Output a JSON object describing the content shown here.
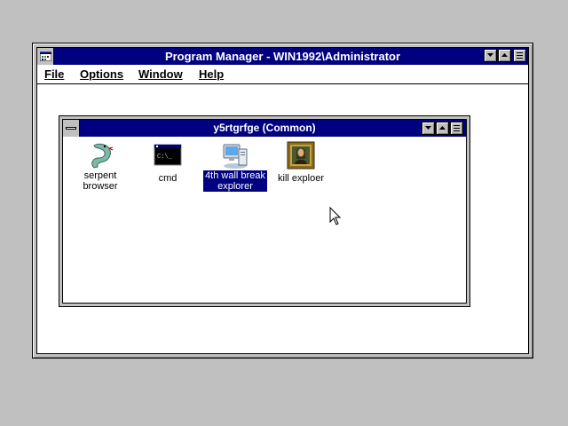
{
  "program_manager": {
    "title": "Program Manager - WIN1992\\Administrator",
    "menu": [
      "File",
      "Options",
      "Window",
      "Help"
    ]
  },
  "group": {
    "title": "y5rtgrfge (Common)",
    "icons": [
      {
        "label": "serpent\nbrowser",
        "icon": "serpent-icon",
        "selected": false
      },
      {
        "label": "cmd",
        "icon": "command-prompt-icon",
        "selected": false
      },
      {
        "label": "4th wall break\nexplorer",
        "icon": "computer-icon",
        "selected": true
      },
      {
        "label": "kill exploer",
        "icon": "framed-portrait-icon",
        "selected": false
      }
    ]
  },
  "colors": {
    "titlebar": "#000080",
    "desktop": "#c0c0c0",
    "selection": "#000080"
  }
}
